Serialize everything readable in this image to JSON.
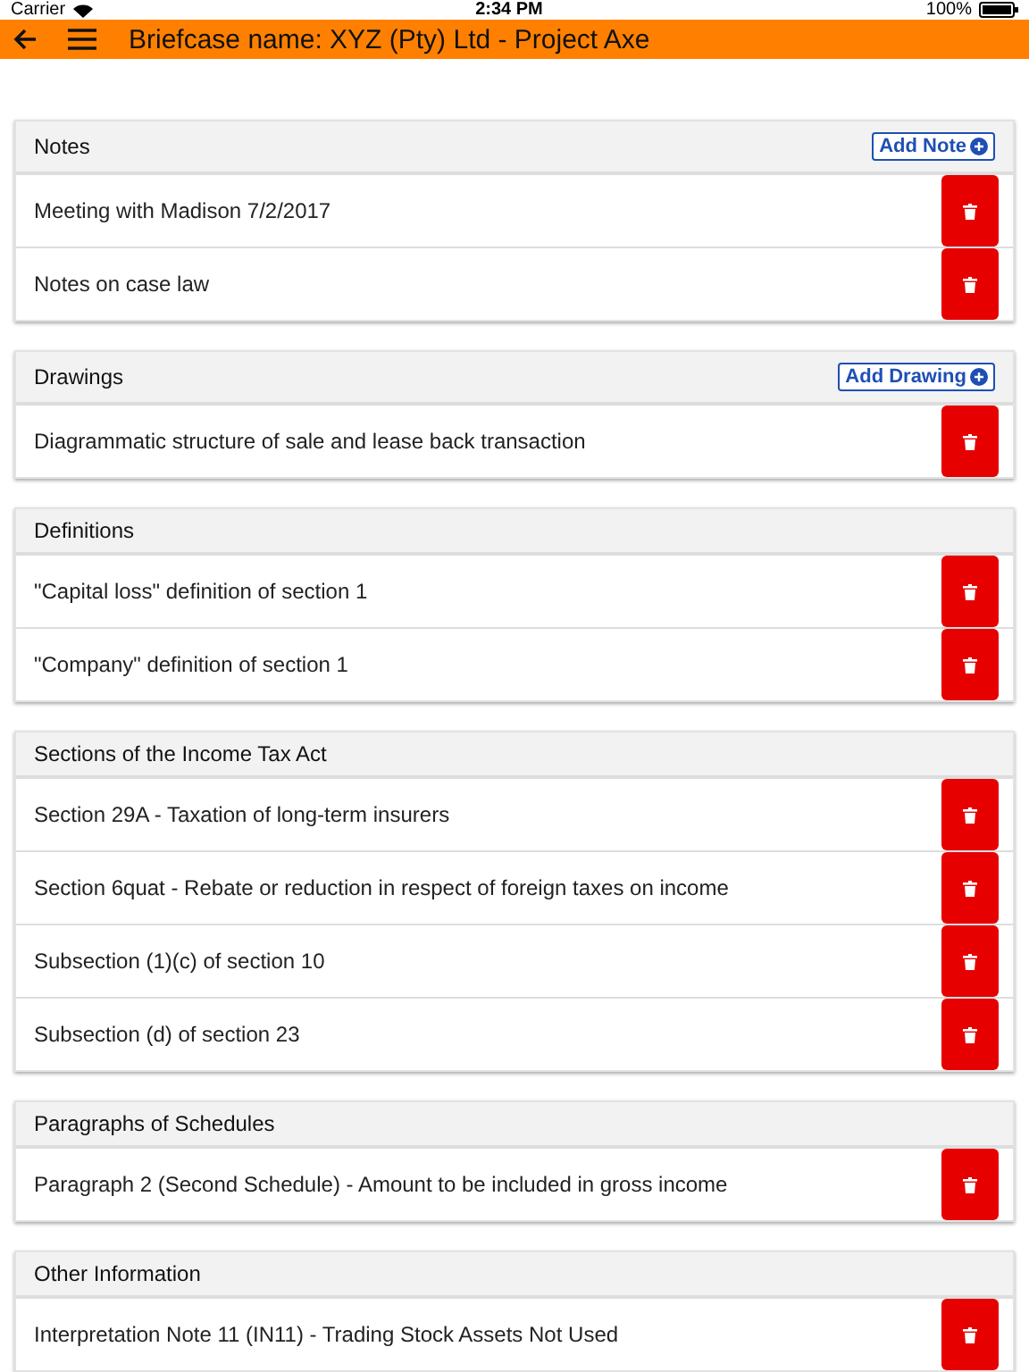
{
  "status_bar": {
    "carrier": "Carrier",
    "time": "2:34 PM",
    "battery": "100%"
  },
  "app_bar": {
    "title": "Briefcase name: XYZ (Pty) Ltd - Project Axe"
  },
  "sections": [
    {
      "title": "Notes",
      "add_button": "Add Note",
      "items": [
        "Meeting with Madison 7/2/2017",
        "Notes on case law"
      ]
    },
    {
      "title": "Drawings",
      "add_button": "Add Drawing",
      "items": [
        "Diagrammatic structure of sale and lease back transaction"
      ]
    },
    {
      "title": "Definitions",
      "items": [
        "\"Capital loss\" definition of section 1",
        "\"Company\" definition of section 1"
      ]
    },
    {
      "title": "Sections of the Income Tax Act",
      "items": [
        "Section 29A - Taxation of long-term insurers",
        "Section 6quat - Rebate or reduction in respect of foreign taxes on income",
        "Subsection (1)(c) of section 10",
        "Subsection (d) of section 23"
      ]
    },
    {
      "title": "Paragraphs of Schedules",
      "items": [
        "Paragraph 2 (Second Schedule) - Amount to be included in gross income"
      ]
    },
    {
      "title": "Other Information",
      "items": [
        "Interpretation Note 11 (IN11) - Trading Stock Assets Not Used"
      ]
    }
  ]
}
